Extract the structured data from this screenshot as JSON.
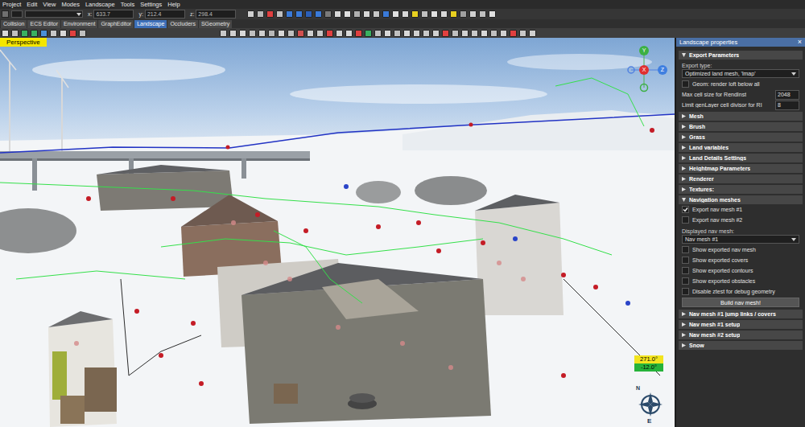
{
  "menu": [
    "Project",
    "Edit",
    "View",
    "Modes",
    "Landscape",
    "Tools",
    "Settings",
    "Help"
  ],
  "toolbar": {
    "coords": [
      {
        "label": "x:",
        "value": "633.7"
      },
      {
        "label": "y:",
        "value": "212.4"
      },
      {
        "label": "z:",
        "value": "298.4"
      }
    ]
  },
  "tabs": [
    {
      "label": "Collision",
      "selected": false
    },
    {
      "label": "ECS Editor",
      "selected": false
    },
    {
      "label": "Environment",
      "selected": false
    },
    {
      "label": "GraphEditor",
      "selected": false
    },
    {
      "label": "Landscape",
      "selected": true
    },
    {
      "label": "Occluders",
      "selected": false
    },
    {
      "label": "SGeometry",
      "selected": false
    }
  ],
  "viewport": {
    "label": "Perspective",
    "gizmo": {
      "y": "Y",
      "x": "X",
      "z": "Z"
    },
    "heading": "271.0°",
    "pitch": "-12.0°",
    "compass": [
      "N",
      "E"
    ]
  },
  "panel": {
    "title": "Landscape properties",
    "close": "×",
    "items": [
      {
        "kind": "section",
        "label": "Export Parameters",
        "expanded": true
      },
      {
        "kind": "label",
        "label": "Export type:"
      },
      {
        "kind": "dropdown",
        "value": "Optimized land mesh, 'lmap'"
      },
      {
        "kind": "checkbox",
        "label": "Geom: render loft below all",
        "checked": false
      },
      {
        "kind": "number",
        "label": "Max cell size for RendInst",
        "value": "2048"
      },
      {
        "kind": "number",
        "label": "Limit genLayer cell divisor for RI",
        "value": "8"
      },
      {
        "kind": "section",
        "label": "Mesh",
        "expanded": false
      },
      {
        "kind": "section",
        "label": "Brush",
        "expanded": false
      },
      {
        "kind": "section",
        "label": "Grass",
        "expanded": false
      },
      {
        "kind": "section",
        "label": "Land variables",
        "expanded": false
      },
      {
        "kind": "section",
        "label": "Land Details Settings",
        "expanded": false
      },
      {
        "kind": "section",
        "label": "Heightmap Parameters",
        "expanded": false
      },
      {
        "kind": "section",
        "label": "Renderer",
        "expanded": false
      },
      {
        "kind": "section",
        "label": "Textures:",
        "expanded": false
      },
      {
        "kind": "section",
        "label": "Navigation meshes",
        "expanded": true
      },
      {
        "kind": "checkbox",
        "label": "Export nav mesh #1",
        "checked": true
      },
      {
        "kind": "checkbox",
        "label": "Export nav mesh #2",
        "checked": false
      },
      {
        "kind": "label",
        "label": "Displayed nav mesh:"
      },
      {
        "kind": "dropdown",
        "value": "Nav mesh #1"
      },
      {
        "kind": "checkbox",
        "label": "Show exported nav mesh",
        "checked": false
      },
      {
        "kind": "checkbox",
        "label": "Show exported covers",
        "checked": false
      },
      {
        "kind": "checkbox",
        "label": "Show exported contours",
        "checked": false
      },
      {
        "kind": "checkbox",
        "label": "Show exported obstacles",
        "checked": false
      },
      {
        "kind": "checkbox",
        "label": "Disable ztest for debug geometry",
        "checked": false
      },
      {
        "kind": "button",
        "label": "Build nav mesh!"
      },
      {
        "kind": "section",
        "label": "Nav mesh #1 jump links / covers",
        "expanded": false
      },
      {
        "kind": "section",
        "label": "Nav mesh #1 setup",
        "expanded": false
      },
      {
        "kind": "section",
        "label": "Nav mesh #2 setup",
        "expanded": false
      },
      {
        "kind": "section",
        "label": "Snow",
        "expanded": false
      }
    ]
  }
}
